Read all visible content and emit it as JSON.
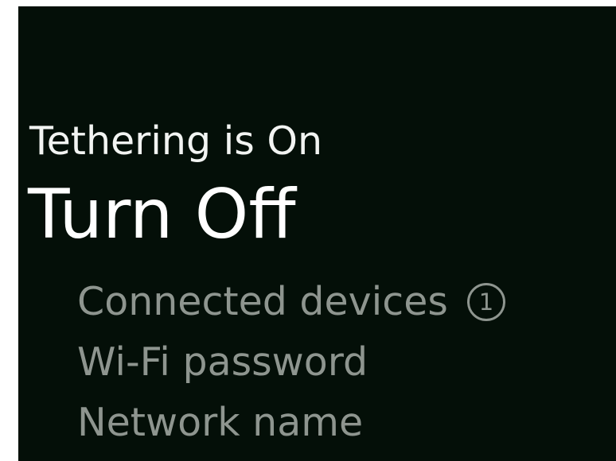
{
  "tethering": {
    "status_title": "Tethering is On",
    "action_label": "Turn Off"
  },
  "menu": {
    "items": [
      {
        "label": "Connected devices",
        "badge": "1"
      },
      {
        "label": "Wi-Fi password"
      },
      {
        "label": "Network name"
      }
    ]
  },
  "colors": {
    "background": "#040f08",
    "primary_text": "#ffffff",
    "secondary_text": "#8e958f"
  }
}
